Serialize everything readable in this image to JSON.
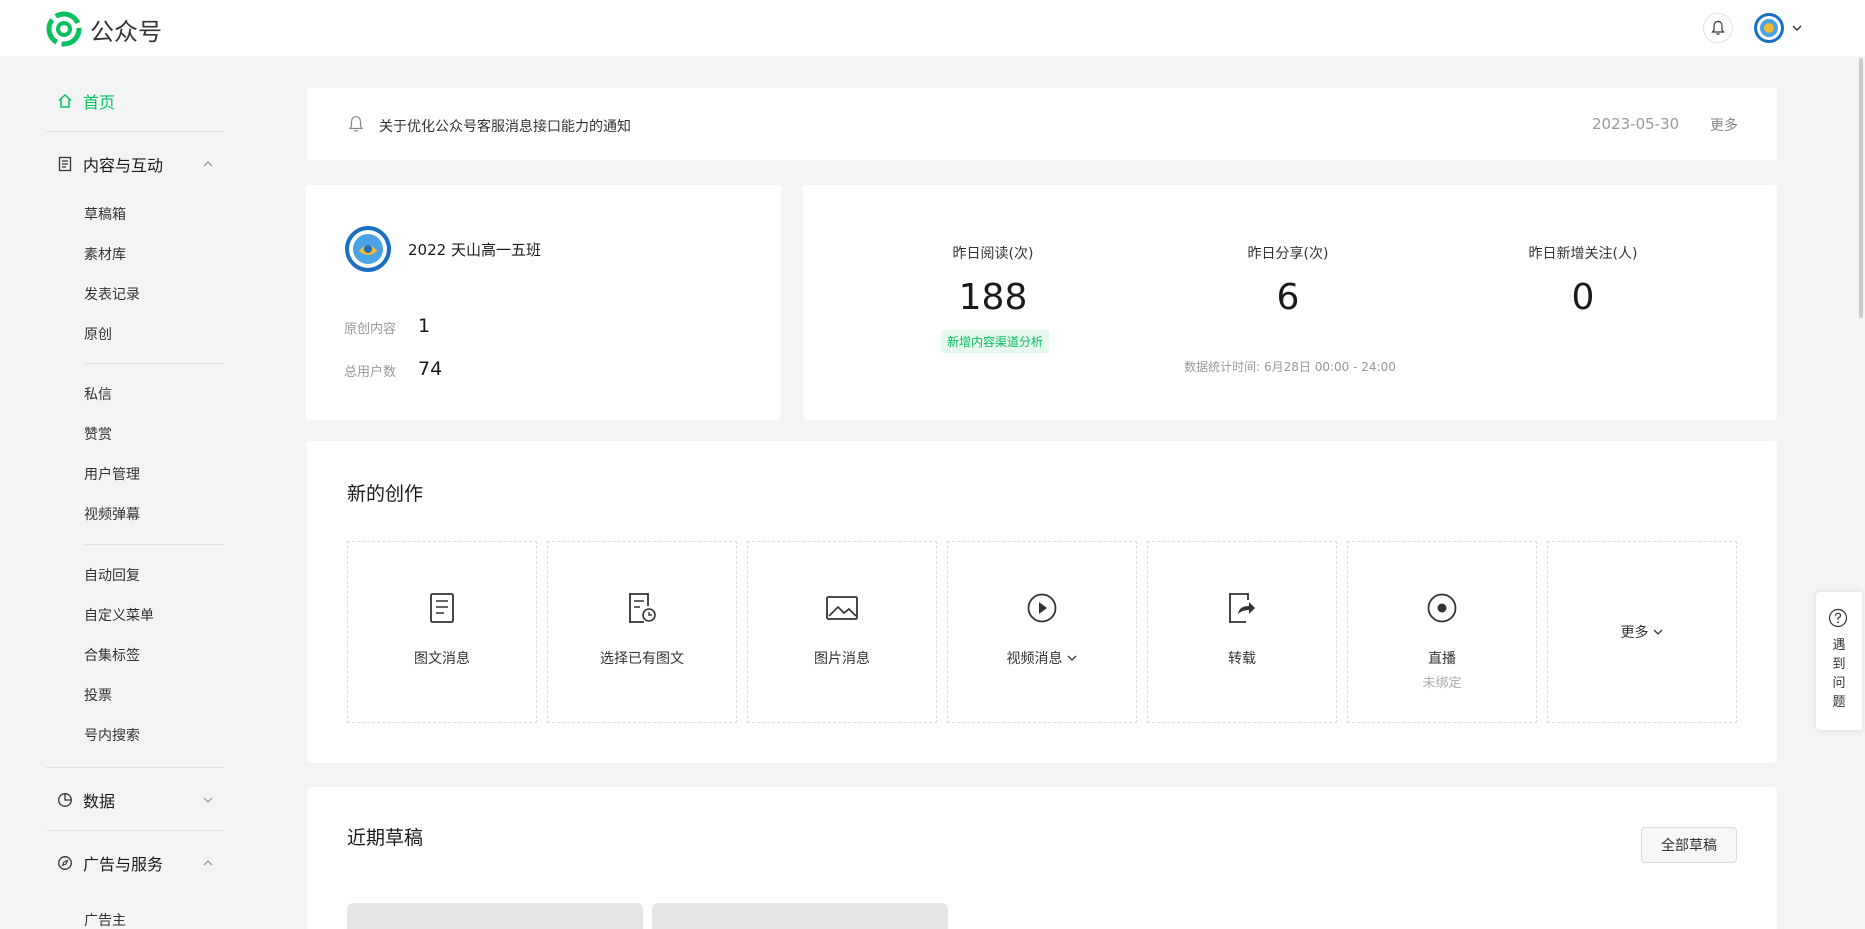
{
  "header": {
    "app_name": "公众号",
    "avatar": "account-avatar"
  },
  "sidebar": {
    "home": "首页",
    "content_section": "内容与互动",
    "content_items": [
      "草稿箱",
      "素材库",
      "发表记录",
      "原创"
    ],
    "interaction_items": [
      "私信",
      "赞赏",
      "用户管理",
      "视频弹幕"
    ],
    "feature_items": [
      "自动回复",
      "自定义菜单",
      "合集标签",
      "投票",
      "号内搜索"
    ],
    "data_section": "数据",
    "ads_section": "广告与服务",
    "ads_items": [
      "广告主"
    ]
  },
  "notice": {
    "text": "关于优化公众号客服消息接口能力的通知",
    "date": "2023-05-30",
    "more": "更多"
  },
  "account": {
    "name": "2022 天山高一五班",
    "original_label": "原创内容",
    "original_value": "1",
    "users_label": "总用户数",
    "users_value": "74"
  },
  "stats": {
    "reads_label": "昨日阅读(次)",
    "reads_value": "188",
    "shares_label": "昨日分享(次)",
    "shares_value": "6",
    "follows_label": "昨日新增关注(人)",
    "follows_value": "0",
    "channel_link": "新增内容渠道分析",
    "time_note": "数据统计时间: 6月28日 00:00 - 24:00"
  },
  "create": {
    "title": "新的创作",
    "tiles": [
      {
        "label": "图文消息",
        "icon": "article-icon"
      },
      {
        "label": "选择已有图文",
        "icon": "existing-article-icon"
      },
      {
        "label": "图片消息",
        "icon": "image-icon"
      },
      {
        "label": "视频消息",
        "icon": "video-play-icon"
      },
      {
        "label": "转载",
        "icon": "repost-icon"
      },
      {
        "label": "直播",
        "sub": "未绑定",
        "icon": "live-icon"
      },
      {
        "label": "更多",
        "icon": "chevron-down-icon"
      }
    ]
  },
  "drafts": {
    "title": "近期草稿",
    "all_button": "全部草稿"
  },
  "help": {
    "text": "遇到问题"
  },
  "colors": {
    "brand_green": "#07c160",
    "background": "#f3f4f6"
  }
}
